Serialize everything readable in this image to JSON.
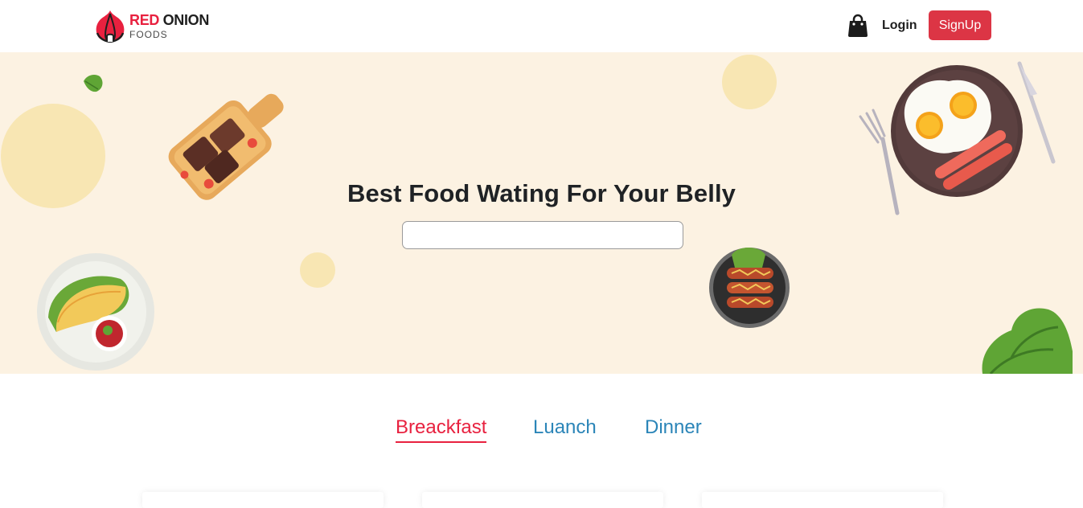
{
  "brand": {
    "name_part1": "RED",
    "name_part2": "ONION",
    "subtitle": "FOODS"
  },
  "nav": {
    "login_label": "Login",
    "signup_label": "SignUp",
    "cart_icon": "shopping-bag-icon"
  },
  "hero": {
    "title": "Best Food Wating For Your Belly",
    "search_value": "",
    "search_placeholder": ""
  },
  "tabs": [
    {
      "label": "Breackfast",
      "active": true
    },
    {
      "label": "Luanch",
      "active": false
    },
    {
      "label": "Dinner",
      "active": false
    }
  ],
  "colors": {
    "brand_red": "#e8213f",
    "button_red": "#dc3545",
    "tab_blue": "#2b85b8",
    "hero_bg": "#fcf2e2"
  }
}
